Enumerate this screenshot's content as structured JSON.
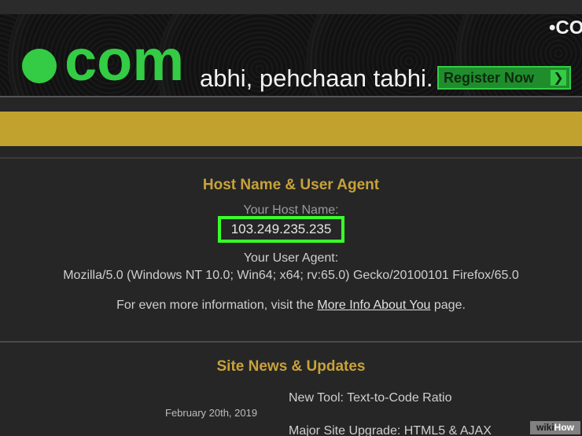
{
  "banner": {
    "brand_text": "com",
    "tagline": "abhi, pehchaan tabhi.",
    "register_label": "Register Now",
    "register_arrow": "❯",
    "corner_logo": "•CO"
  },
  "colors": {
    "background": "#262626",
    "gold_bar": "#c1a22f",
    "heading": "#c8a23a",
    "brand_green": "#33cc44",
    "highlight_green": "#39ff2a"
  },
  "host_section": {
    "title": "Host Name & User Agent",
    "host_label": "Your Host Name:",
    "host_value": "103.249.235.235",
    "ua_label": "Your User Agent:",
    "ua_value": "Mozilla/5.0 (Windows NT 10.0; Win64; x64; rv:65.0) Gecko/20100101 Firefox/65.0",
    "info_prefix": "For even more information, visit the ",
    "info_link": "More Info About You",
    "info_suffix": " page."
  },
  "news_section": {
    "title": "Site News & Updates",
    "date": "February 20th, 2019",
    "items": [
      "New Tool: Text-to-Code Ratio",
      "Major Site Upgrade: HTML5 & AJAX"
    ]
  },
  "watermark": {
    "part1": "wiki",
    "part2": "How"
  }
}
